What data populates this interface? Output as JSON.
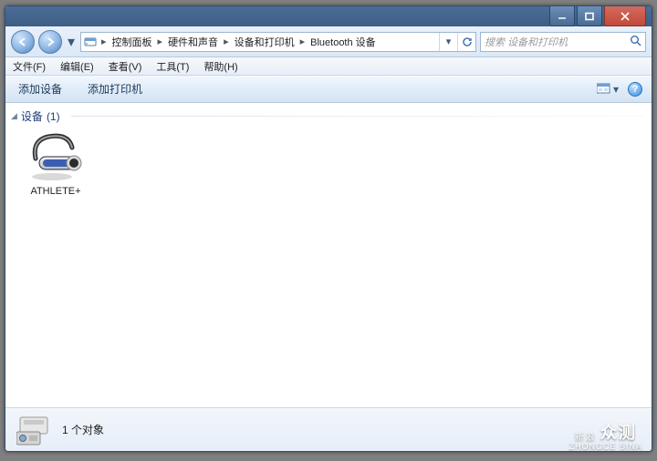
{
  "titlebar": {
    "min": "—",
    "max": "☐",
    "close": "✕"
  },
  "breadcrumbs": [
    "控制面板",
    "硬件和声音",
    "设备和打印机",
    "Bluetooth 设备"
  ],
  "search": {
    "placeholder": "搜索 设备和打印机"
  },
  "menu": {
    "file": "文件(F)",
    "edit": "编辑(E)",
    "view": "查看(V)",
    "tools": "工具(T)",
    "help": "帮助(H)"
  },
  "toolbar": {
    "add_device": "添加设备",
    "add_printer": "添加打印机"
  },
  "group": {
    "label": "设备",
    "count": "(1)"
  },
  "devices": [
    {
      "name": "ATHLETE+"
    }
  ],
  "details": {
    "count_label": "1 个对象"
  },
  "watermark": {
    "line1": "新浪",
    "line2": "众测",
    "line3": "ZHONGCE SINA"
  }
}
